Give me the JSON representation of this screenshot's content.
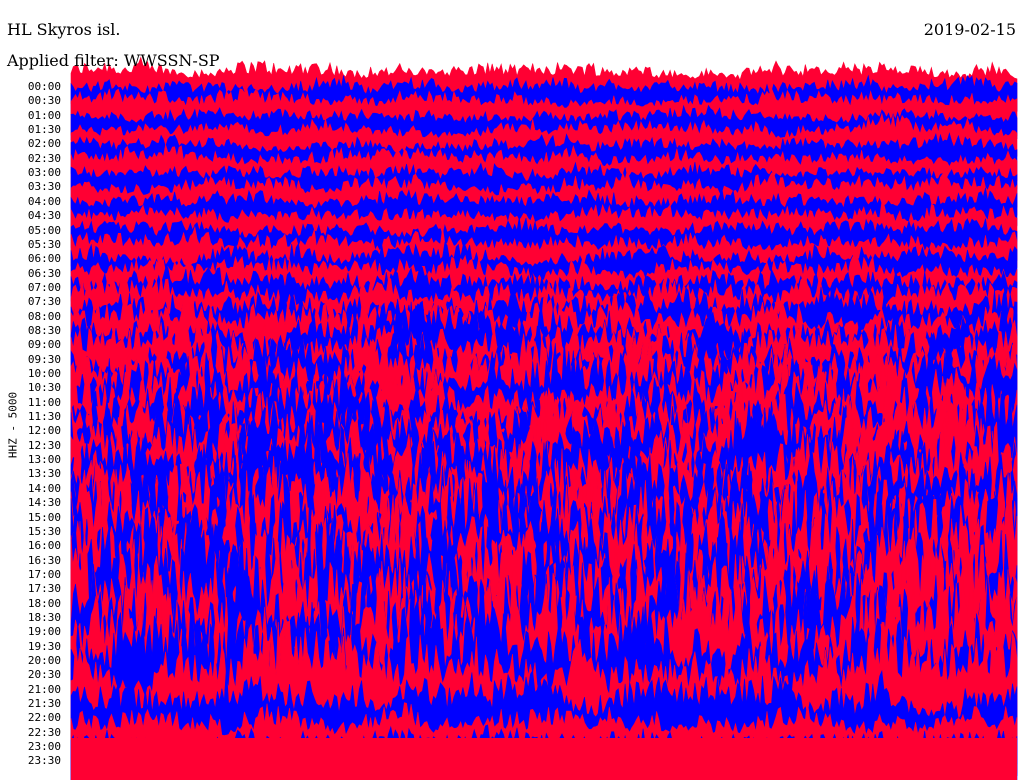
{
  "header": {
    "station": "HL Skyros isl.",
    "date": "2019-02-15",
    "filter": "Applied filter: WWSSN-SP"
  },
  "channel_label": "HHZ - 5000",
  "colors": {
    "trace_a": "#ff0033",
    "trace_b": "#0000ff",
    "background": "#ffffff"
  },
  "chart_data": {
    "type": "line",
    "title": "HL Skyros isl.",
    "subtitle": "Applied filter: WWSSN-SP",
    "ylabel": "HHZ - 5000",
    "date": "2019-02-15",
    "row_labels": [
      "00:00",
      "00:30",
      "01:00",
      "01:30",
      "02:00",
      "02:30",
      "03:00",
      "03:30",
      "04:00",
      "04:30",
      "05:00",
      "05:30",
      "06:00",
      "06:30",
      "07:00",
      "07:30",
      "08:00",
      "08:30",
      "09:00",
      "09:30",
      "10:00",
      "10:30",
      "11:00",
      "11:30",
      "12:00",
      "12:30",
      "13:00",
      "13:30",
      "14:00",
      "14:30",
      "15:00",
      "15:30",
      "16:00",
      "16:30",
      "17:00",
      "17:30",
      "18:00",
      "18:30",
      "19:00",
      "19:30",
      "20:00",
      "20:30",
      "21:00",
      "21:30",
      "22:00",
      "22:30",
      "23:00",
      "23:30"
    ],
    "row_colors": [
      "red",
      "blue",
      "red",
      "blue",
      "red",
      "blue",
      "red",
      "blue",
      "red",
      "blue",
      "red",
      "blue",
      "red",
      "blue",
      "red",
      "blue",
      "red",
      "blue",
      "red",
      "blue",
      "red",
      "blue",
      "red",
      "blue",
      "red",
      "blue",
      "red",
      "blue",
      "red",
      "blue",
      "red",
      "blue",
      "red",
      "blue",
      "red",
      "blue",
      "red",
      "blue",
      "red",
      "blue",
      "red",
      "blue",
      "red",
      "blue",
      "red",
      "blue",
      "red",
      "blue"
    ],
    "row_amplitude": [
      1.2,
      1.1,
      1.2,
      1.1,
      1.2,
      1.2,
      1.2,
      1.2,
      1.3,
      1.2,
      1.2,
      1.3,
      1.3,
      1.4,
      1.4,
      1.6,
      1.8,
      2.0,
      2.2,
      2.4,
      2.6,
      2.8,
      3.0,
      3.0,
      3.2,
      3.3,
      3.4,
      3.6,
      3.8,
      4.0,
      4.2,
      4.4,
      4.6,
      4.8,
      5.0,
      5.2,
      5.3,
      5.4,
      5.5,
      5.6,
      5.6,
      5.5,
      5.4,
      5.0,
      4.0,
      3.0,
      2.0,
      1.5
    ],
    "grid": false
  }
}
